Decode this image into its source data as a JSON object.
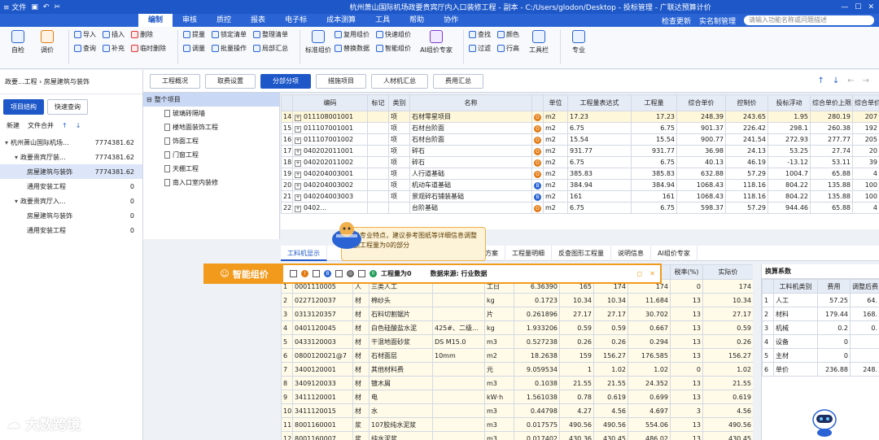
{
  "titlebar": {
    "file_label": "≡ 文件",
    "title": "杭州萧山国际机场政要贵宾厅内入口装修工程 - 副本 - C:/Users/glodon/Desktop - 投标管理 - 广联达预算计价"
  },
  "menu": {
    "tabs": [
      "编制",
      "审核",
      "质控",
      "报表",
      "电子标",
      "成本测算",
      "工具",
      "帮助",
      "协作"
    ],
    "active": "编制",
    "check_update": "检查更新",
    "realname": "实名制管理",
    "search_placeholder": "请输入功能名称或问题描述"
  },
  "ribbon": {
    "big1": "自检",
    "big2": "调价",
    "col1": [
      "导入",
      "查询"
    ],
    "col2": [
      "插入",
      "补充"
    ],
    "col3": [
      "删除",
      "临时删除"
    ],
    "col4": [
      "提量",
      "调量"
    ],
    "col5": [
      "锁定清单",
      "批量操作"
    ],
    "col6": [
      "整理清单",
      "局部汇总"
    ],
    "big3": "标准组价",
    "col7": [
      "复用组价",
      "替换数据"
    ],
    "col8": [
      "快速组价",
      "智能组价"
    ],
    "big4": "AI组价专家",
    "col9": [
      "查找",
      "过滤"
    ],
    "col10": [
      "颜色",
      "行高"
    ],
    "big5": "工具栏",
    "big6": "专业"
  },
  "leftpanel": {
    "breadcrumb": "政要...工程 › 房屋建筑与装饰",
    "tab1": "项目结构",
    "tab2": "快速查询",
    "new": "新建",
    "merge": "文件合并",
    "tree": [
      {
        "name": "杭州萧山国际机场...",
        "value": "7774381.62",
        "level": 0
      },
      {
        "name": "政要贵宾厅装...",
        "value": "7774381.62",
        "level": 1
      },
      {
        "name": "房屋建筑与装饰",
        "value": "7774381.62",
        "level": 2,
        "sel": true
      },
      {
        "name": "通用安装工程",
        "value": "0",
        "level": 2
      },
      {
        "name": "政要贵宾厅入...",
        "value": "0",
        "level": 1
      },
      {
        "name": "房屋建筑与装饰",
        "value": "0",
        "level": 2
      },
      {
        "name": "通用安装工程",
        "value": "0",
        "level": 2
      }
    ]
  },
  "subtree": {
    "root": "整个项目",
    "items": [
      "玻璃砖隔墙",
      "楼地面装饰工程",
      "饰面工程",
      "门窗工程",
      "天棚工程",
      "南入口室内装修"
    ]
  },
  "toptabs": {
    "tabs": [
      "工程概况",
      "取费设置",
      "分部分项",
      "措施项目",
      "人材机汇总",
      "费用汇总"
    ],
    "active": "分部分项"
  },
  "maingrid": {
    "headers": [
      "",
      "编码",
      "标记",
      "类别",
      "名称",
      "",
      "单位",
      "工程量表达式",
      "工程量",
      "综合单价",
      "控制价",
      "投标浮动",
      "综合单价上限",
      "综合单价下限"
    ],
    "rows": [
      [
        "14",
        "011108001001",
        "",
        "项",
        "石材零星项目",
        "O",
        "m2",
        "17.23",
        "17.23",
        "248.39",
        "243.65",
        "1.95",
        "280.19",
        "207"
      ],
      [
        "15",
        "011107001001",
        "",
        "项",
        "石材台阶面",
        "O",
        "m2",
        "6.75",
        "6.75",
        "901.37",
        "226.42",
        "298.1",
        "260.38",
        "192"
      ],
      [
        "16",
        "011107001002",
        "",
        "项",
        "石材台阶面",
        "O",
        "m2",
        "15.54",
        "15.54",
        "900.77",
        "241.54",
        "272.93",
        "277.77",
        "205"
      ],
      [
        "17",
        "040202011001",
        "",
        "项",
        "碎石",
        "O",
        "m2",
        "931.77",
        "931.77",
        "36.98",
        "24.13",
        "53.25",
        "27.74",
        "20"
      ],
      [
        "18",
        "040202011002",
        "",
        "项",
        "碎石",
        "O",
        "m2",
        "6.75",
        "6.75",
        "40.13",
        "46.19",
        "-13.12",
        "53.11",
        "39"
      ],
      [
        "19",
        "040204003001",
        "",
        "项",
        "人行道基础",
        "O",
        "m2",
        "385.83",
        "385.83",
        "632.88",
        "57.29",
        "1004.7",
        "65.88",
        "4"
      ],
      [
        "20",
        "040204003002",
        "",
        "项",
        "机动车道基础",
        "B",
        "m2",
        "384.94",
        "384.94",
        "1068.43",
        "118.16",
        "804.22",
        "135.88",
        "100"
      ],
      [
        "21",
        "040204003003",
        "",
        "项",
        "景观碎石铺装基础",
        "B",
        "m2",
        "161",
        "161",
        "1068.43",
        "118.16",
        "804.22",
        "135.88",
        "100"
      ],
      [
        "22",
        "0402…",
        "",
        "",
        "台阶基础",
        "O",
        "m2",
        "6.75",
        "6.75",
        "598.37",
        "57.29",
        "944.46",
        "65.88",
        "4"
      ]
    ]
  },
  "tooltip": "鉴于专业特点，建议参考图纸等详细信息调整定额工程量为0的部分",
  "btabs": {
    "tabs": [
      "工料机显示",
      "",
      "组价方案",
      "工程量明细",
      "反查图形工程量",
      "说明信息",
      "AI组价专家"
    ],
    "active": "工料机显示"
  },
  "aibar": {
    "label": "智能组价",
    "zero_label": "工程量为0",
    "source": "数据来源: 行业数据"
  },
  "subgrid": {
    "headers": [
      "",
      "编码",
      "类别",
      "名称",
      "规格型号",
      "单位",
      "损耗含量",
      "含量",
      "数量",
      "市场价",
      "税率(%)",
      "实际价"
    ],
    "rows": [
      [
        "1",
        "0001110005",
        "人",
        "三类人工",
        "",
        "工日",
        "6.36390",
        "165",
        "174",
        "174",
        "0",
        "174"
      ],
      [
        "2",
        "0227120037",
        "材",
        "棉纱头",
        "",
        "kg",
        "0.1723",
        "10.34",
        "10.34",
        "11.684",
        "13",
        "10.34"
      ],
      [
        "3",
        "0313120357",
        "材",
        "石料切割锯片",
        "",
        "片",
        "0.261896",
        "27.17",
        "27.17",
        "30.702",
        "13",
        "27.17"
      ],
      [
        "4",
        "0401120045",
        "材",
        "白色硅酸盐水泥",
        "425#、二级…",
        "kg",
        "1.933206",
        "0.59",
        "0.59",
        "0.667",
        "13",
        "0.59"
      ],
      [
        "5",
        "0433120003",
        "材",
        "干混地面砂浆",
        "DS M15.0",
        "m3",
        "0.527238",
        "0.26",
        "0.26",
        "0.294",
        "13",
        "0.26"
      ],
      [
        "6",
        "0800120021@7",
        "材",
        "石材面层",
        "10mm",
        "m2",
        "18.2638",
        "159",
        "156.27",
        "176.585",
        "13",
        "156.27"
      ],
      [
        "7",
        "3400120001",
        "材",
        "其他材料费",
        "",
        "元",
        "9.059534",
        "1",
        "1.02",
        "1.02",
        "0",
        "1.02"
      ],
      [
        "8",
        "3409120033",
        "材",
        "镀木屑",
        "",
        "m3",
        "0.1038",
        "21.55",
        "21.55",
        "24.352",
        "13",
        "21.55"
      ],
      [
        "9",
        "3411120001",
        "材",
        "电",
        "",
        "kW·h",
        "1.561038",
        "0.78",
        "0.619",
        "0.699",
        "13",
        "0.619"
      ],
      [
        "10",
        "3411120015",
        "材",
        "水",
        "",
        "m3",
        "0.44798",
        "4.27",
        "4.56",
        "4.697",
        "3",
        "4.56"
      ],
      [
        "11",
        "8001160001",
        "浆",
        "107胶纯水泥浆",
        "",
        "m3",
        "0.017575",
        "490.56",
        "490.56",
        "554.06",
        "13",
        "490.56"
      ],
      [
        "12",
        "8001160007",
        "浆",
        "纯水泥浆",
        "",
        "m3",
        "0.017402",
        "430.36",
        "430.45",
        "486.02",
        "13",
        "430.45"
      ]
    ]
  },
  "rightpanel": {
    "title": "换算系数",
    "headers": [
      "",
      "工料机类别",
      "费用",
      "调整后费"
    ],
    "rows": [
      [
        "1",
        "人工",
        "57.25",
        "64."
      ],
      [
        "2",
        "材料",
        "179.44",
        "168."
      ],
      [
        "3",
        "机械",
        "0.2",
        "0."
      ],
      [
        "4",
        "设备",
        "0",
        ""
      ],
      [
        "5",
        "主材",
        "0",
        ""
      ],
      [
        "6",
        "单价",
        "236.88",
        "248."
      ]
    ]
  },
  "watermark": "大数跨境",
  "colors": {
    "accent": "#1e58c8",
    "orange": "#f19a1c"
  }
}
